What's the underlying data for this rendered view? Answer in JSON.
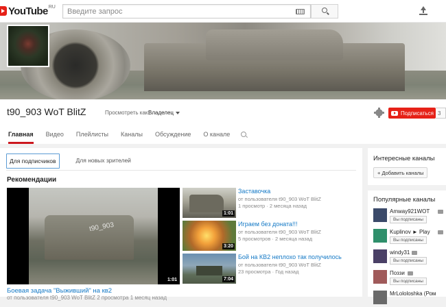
{
  "header": {
    "logo_text": "YouTube",
    "logo_region": "RU",
    "search_placeholder": "Введите запрос"
  },
  "channel": {
    "title": "t90_903 WoT BlitZ",
    "view_as_label": "Просмотреть как:",
    "view_as_value": "Владелец",
    "subscribe_label": "Подписаться",
    "subscriber_count": "3"
  },
  "tabs": [
    {
      "label": "Главная",
      "active": true
    },
    {
      "label": "Видео"
    },
    {
      "label": "Плейлисты"
    },
    {
      "label": "Каналы"
    },
    {
      "label": "Обсуждение"
    },
    {
      "label": "О канале"
    }
  ],
  "subtabs": [
    {
      "label": "Для подписчиков",
      "active": true
    },
    {
      "label": "Для новых зрителей"
    }
  ],
  "recommendations": {
    "title": "Рекомендации",
    "featured": {
      "title": "Боевая задача \"Выживший\" на кв2",
      "meta": "от пользователя t90_903 WoT BlitZ 2 просмотра 1 месяц назад",
      "duration": "1:01",
      "watermark": "t90_903"
    },
    "videos": [
      {
        "title": "Заставочка",
        "author": "от пользователя t90_903 WoT BlitZ",
        "views": "1 просмотр",
        "age": "2 месяца назад",
        "duration": "1:01"
      },
      {
        "title": "Играем без доната!!!",
        "author": "от пользователя t90_903 WoT BlitZ",
        "views": "5 просмотров",
        "age": "2 месяца назад",
        "duration": "3:20"
      },
      {
        "title": "Бой на КВ2 неплохо так получилось",
        "author": "от пользователя t90_903 WoT BlitZ",
        "views": "23 просмотра",
        "age": "Год назад",
        "duration": "7:04"
      }
    ]
  },
  "sidebar": {
    "interesting_title": "Интересные каналы",
    "add_channels_label": "+ Добавить каналы",
    "popular_title": "Популярные каналы",
    "popular": [
      {
        "name": "Amway921WOT",
        "button": "Вы подписаны",
        "color": "#3b4a6a"
      },
      {
        "name": "Kuplinov ► Play",
        "button": "Вы подписаны",
        "color": "#2f8f6b"
      },
      {
        "name": "windy31",
        "button": "Вы подписаны",
        "color": "#4a4066"
      },
      {
        "name": "Поззи",
        "button": "Вы подписаны",
        "color": "#a05a5a"
      },
      {
        "name": "MrLololoshka (Ром",
        "button": "",
        "color": "#6a6a6a"
      }
    ]
  },
  "colors": {
    "accent_red": "#e62117",
    "link_blue": "#167ac6"
  }
}
